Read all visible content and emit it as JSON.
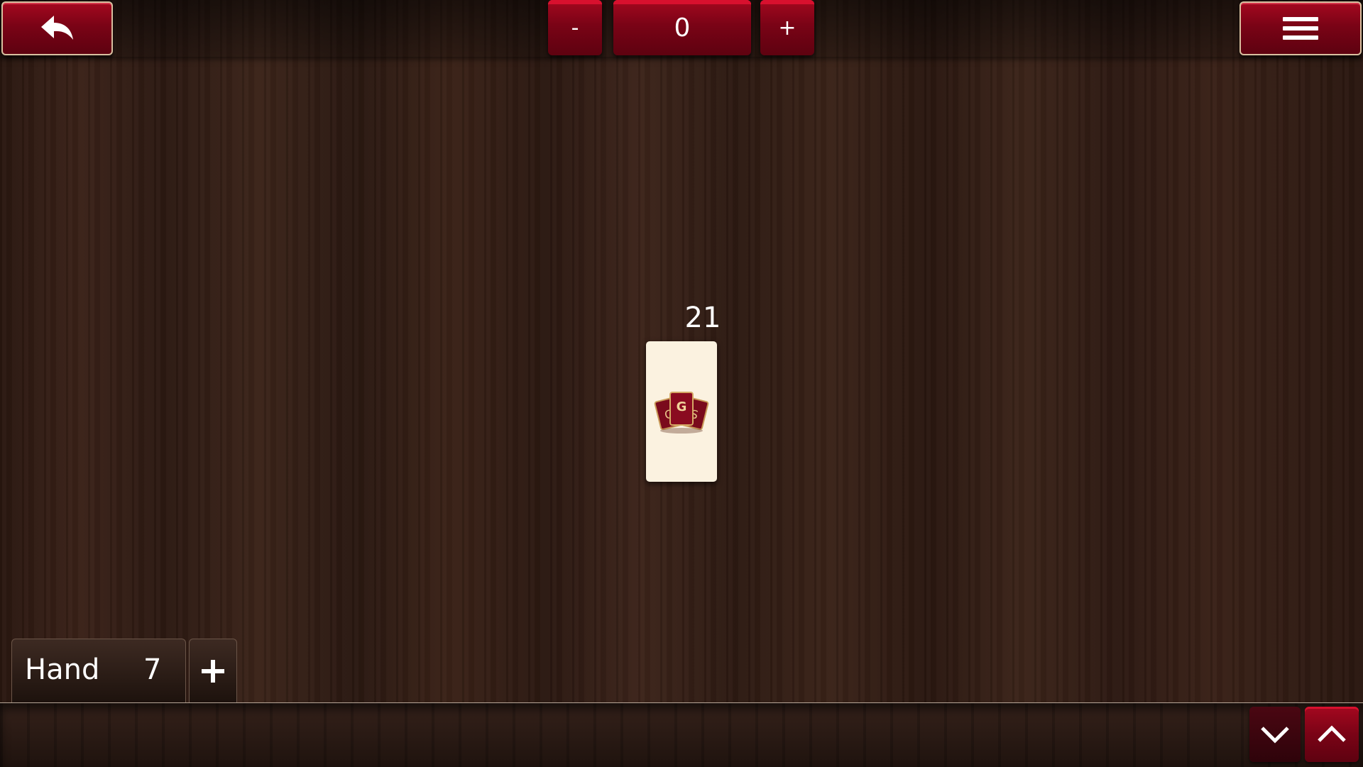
{
  "toolbar": {
    "back_icon": "undo-arrow-icon",
    "menu_icon": "hamburger-menu-icon",
    "decrement_label": "-",
    "counter_value": "0",
    "increment_label": "+"
  },
  "play_area": {
    "stack_count": "21",
    "card_back_logo_text": "CGS"
  },
  "hand": {
    "label": "Hand",
    "count": "7",
    "add_icon": "plus-icon",
    "collapse_icon": "chevron-down-icon",
    "expand_icon": "chevron-up-icon"
  },
  "colors": {
    "accent_red": "#8a0519",
    "card_face": "#fbf2e0",
    "wood_dark": "#2e1a13"
  }
}
